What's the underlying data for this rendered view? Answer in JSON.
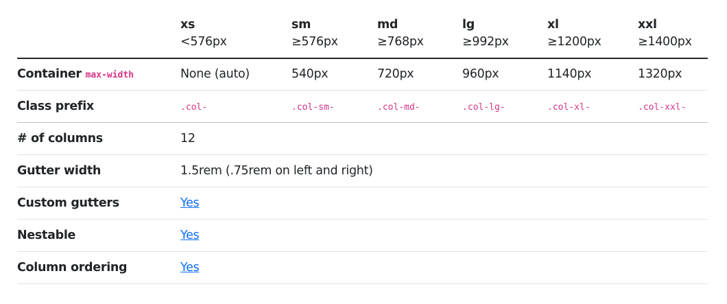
{
  "breakpoints": [
    {
      "name": "xs",
      "range": "<576px"
    },
    {
      "name": "sm",
      "range": "≥576px"
    },
    {
      "name": "md",
      "range": "≥768px"
    },
    {
      "name": "lg",
      "range": "≥992px"
    },
    {
      "name": "xl",
      "range": "≥1200px"
    },
    {
      "name": "xxl",
      "range": "≥1400px"
    }
  ],
  "rows": {
    "container": {
      "label": "Container",
      "code": "max-width",
      "values": [
        "None (auto)",
        "540px",
        "720px",
        "960px",
        "1140px",
        "1320px"
      ]
    },
    "class_prefix": {
      "label": "Class prefix",
      "values": [
        ".col-",
        ".col-sm-",
        ".col-md-",
        ".col-lg-",
        ".col-xl-",
        ".col-xxl-"
      ]
    },
    "columns": {
      "label": "# of columns",
      "value": "12"
    },
    "gutter_width": {
      "label": "Gutter width",
      "value": "1.5rem (.75rem on left and right)"
    },
    "custom_gutters": {
      "label": "Custom gutters",
      "value": "Yes"
    },
    "nestable": {
      "label": "Nestable",
      "value": "Yes"
    },
    "column_ordering": {
      "label": "Column ordering",
      "value": "Yes"
    }
  },
  "colors": {
    "text": "#212529",
    "code": "#d63384",
    "link": "#0d6efd",
    "row_border": "#dee2e6"
  }
}
